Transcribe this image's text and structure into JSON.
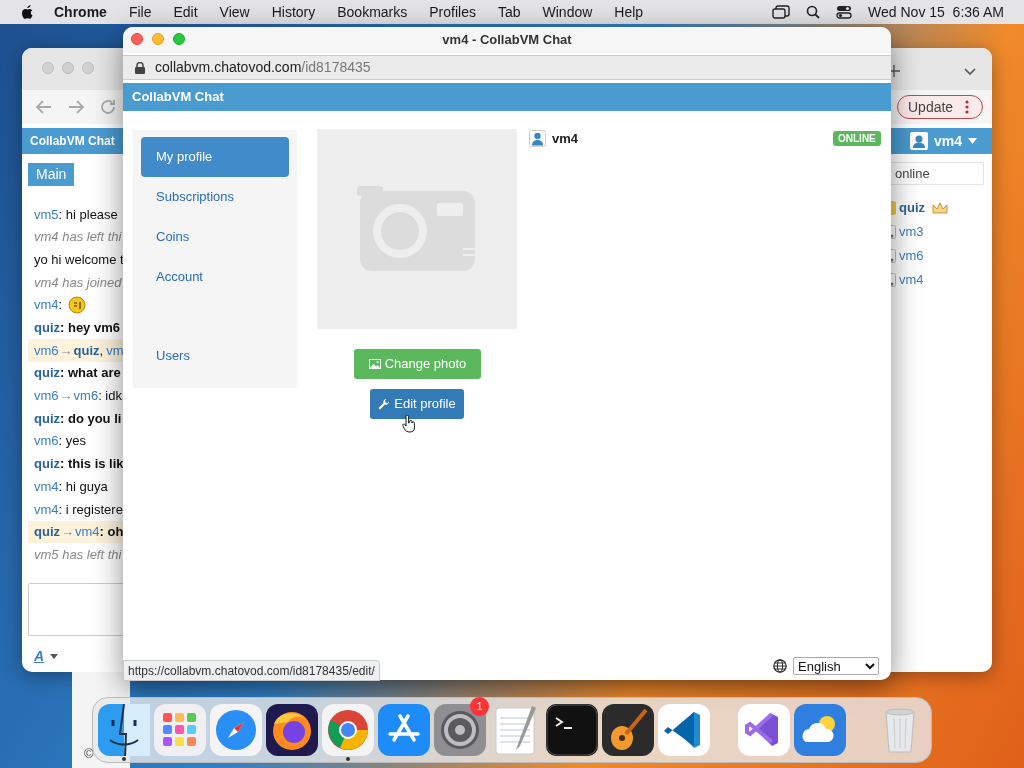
{
  "menu_bar": {
    "app_name": "Chrome",
    "menus": [
      "File",
      "Edit",
      "View",
      "History",
      "Bookmarks",
      "Profiles",
      "Tab",
      "Window",
      "Help"
    ],
    "clock": "Wed Nov 15  6:36 AM"
  },
  "back_window": {
    "header": "CollabVM Chat",
    "tabs": [
      {
        "label": "Main",
        "selected": true
      }
    ],
    "messages": [
      {
        "kind": "message",
        "user": "vm5",
        "admin": false,
        "text": ": hi please",
        "bold": false,
        "highlighted": false
      },
      {
        "kind": "system",
        "text": "vm4 has left thi"
      },
      {
        "kind": "plain",
        "text": "yo hi welcome t"
      },
      {
        "kind": "system",
        "text": "vm4 has joined"
      },
      {
        "kind": "emoji",
        "user": "vm4",
        "admin": false,
        "text": ":",
        "highlighted": false
      },
      {
        "kind": "message",
        "user": "quiz",
        "admin": true,
        "text": ": hey vm6",
        "bold": true,
        "highlighted": false
      },
      {
        "kind": "private",
        "user": "vm6",
        "admin": false,
        "arrow": "→",
        "to": [
          {
            "name": "quiz",
            "admin": true
          },
          {
            "prefix": ",",
            "name": "vm",
            "admin": false
          }
        ],
        "highlighted": true
      },
      {
        "kind": "message",
        "user": "quiz",
        "admin": true,
        "text": ": what are",
        "bold": true,
        "highlighted": false
      },
      {
        "kind": "private",
        "user": "vm6",
        "admin": false,
        "arrow": "→",
        "to": [
          {
            "name": "vm6",
            "admin": false
          }
        ],
        "text": ": idk",
        "bold": false,
        "highlighted": false
      },
      {
        "kind": "message",
        "user": "quiz",
        "admin": true,
        "text": ": do you li",
        "bold": true,
        "highlighted": false
      },
      {
        "kind": "message",
        "user": "vm6",
        "admin": false,
        "text": ": yes",
        "bold": false,
        "highlighted": false
      },
      {
        "kind": "message",
        "user": "quiz",
        "admin": true,
        "text": ": this is lik",
        "bold": true,
        "highlighted": false
      },
      {
        "kind": "message",
        "user": "vm4",
        "admin": false,
        "text": ": hi guya",
        "bold": false,
        "highlighted": false
      },
      {
        "kind": "message",
        "user": "vm4",
        "admin": false,
        "text": ": i registere",
        "bold": false,
        "highlighted": false
      },
      {
        "kind": "private",
        "user": "quiz",
        "admin": true,
        "arrow": "→",
        "to": [
          {
            "name": "vm4",
            "admin": false
          }
        ],
        "text": ": oh",
        "bold": true,
        "highlighted": true
      },
      {
        "kind": "system",
        "text": "vm5 has left thi"
      }
    ],
    "update_button": "Update",
    "current_user": "vm4",
    "user_filter": {
      "value": "online"
    },
    "users": [
      {
        "name": "quiz",
        "admin": true
      },
      {
        "name": "vm3",
        "admin": false
      },
      {
        "name": "vm6",
        "admin": false
      },
      {
        "name": "vm4",
        "admin": false
      }
    ],
    "font_button": "A",
    "copyright": "©"
  },
  "popup": {
    "title": "vm4 - CollabVM Chat",
    "url_domain": "collabvm.chatovod.com",
    "url_path": "/id8178435",
    "header": "CollabVM Chat",
    "nav": [
      {
        "label": "My profile",
        "selected": true
      },
      {
        "label": "Subscriptions",
        "selected": false
      },
      {
        "label": "Coins",
        "selected": false
      },
      {
        "label": "Account",
        "selected": false
      },
      {
        "label": "Users",
        "selected": false,
        "separated": true
      }
    ],
    "buttons": [
      {
        "label": "Change photo",
        "kind": "photo"
      },
      {
        "label": "Edit profile",
        "kind": "edit"
      }
    ],
    "username": "vm4",
    "status": "ONLINE",
    "language": "English",
    "status_url": "https://collabvm.chatovod.com/id8178435/edit/"
  },
  "dock": {
    "apps": [
      {
        "kind": "finder",
        "running": true
      },
      {
        "kind": "launchpad",
        "running": false
      },
      {
        "kind": "safari",
        "running": false
      },
      {
        "kind": "firefox",
        "running": false
      },
      {
        "kind": "chrome",
        "running": true
      },
      {
        "kind": "appstore",
        "running": false
      },
      {
        "kind": "settings",
        "running": false,
        "badge": "1"
      },
      {
        "kind": "textedit",
        "running": false
      },
      {
        "kind": "terminal",
        "running": false
      },
      {
        "kind": "garageband",
        "running": false
      },
      {
        "kind": "vscode",
        "running": false
      },
      {
        "kind": "divider"
      },
      {
        "kind": "visualstudio",
        "running": false
      },
      {
        "kind": "weather",
        "running": false
      },
      {
        "kind": "divider"
      },
      {
        "kind": "trash",
        "running": false
      }
    ]
  }
}
